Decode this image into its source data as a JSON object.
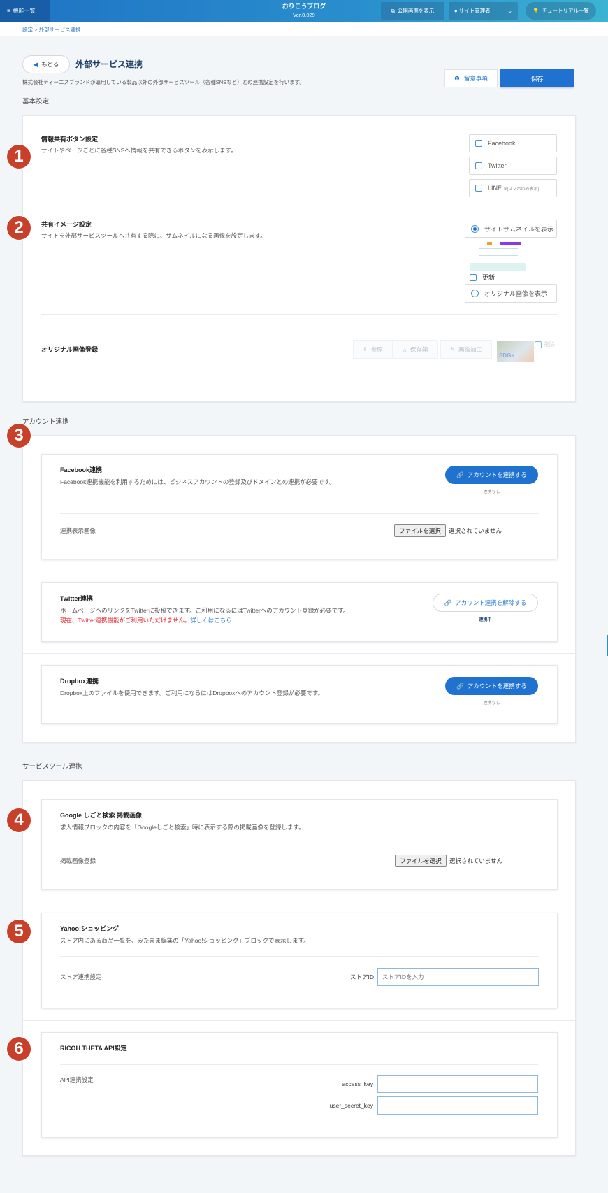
{
  "header": {
    "menu_label": "機能一覧",
    "app_title": "おりこうブログ",
    "version": "Ver.0.029",
    "view_public_label": "公開画面を表示",
    "site_admin_label": "サイト管理者",
    "tutorial_label": "チュートリアル一覧"
  },
  "breadcrumb": {
    "root": "設定",
    "separator": ">",
    "current": "外部サービス連携"
  },
  "page": {
    "back_label": "もどる",
    "title": "外部サービス連携",
    "description": "株式会社ディーエスブランドが運用している製品以外の外部サービスツール（各種SNSなど）との連携設定を行います。",
    "notes_label": "留意事項",
    "save_label": "保存"
  },
  "basic": {
    "heading": "基本設定",
    "share_buttons": {
      "badge": "1",
      "title": "情報共有ボタン設定",
      "description": "サイトやページごとに各種SNSへ情報を共有できるボタンを表示します。",
      "options": [
        {
          "label": "Facebook",
          "note": "",
          "checked": false
        },
        {
          "label": "Twitter",
          "note": "",
          "checked": false
        },
        {
          "label": "LINE",
          "note": "※(スマホのみ表示)",
          "checked": false
        }
      ]
    },
    "share_image": {
      "badge": "2",
      "title": "共有イメージ設定",
      "description": "サイトを外部サービスツールへ共有する際に、サムネイルになる画像を設定します。",
      "option_thumbnail": "サイトサムネイルを表示",
      "thumbnail_selected": true,
      "refresh_label": "更新",
      "option_original": "オリジナル画像を表示"
    },
    "original_image": {
      "label": "オリジナル画像登録",
      "browse_label": "参照",
      "storage_label": "保存箱",
      "edit_label": "画像加工",
      "thumb_text": "SDGs",
      "delete_label": "削除"
    }
  },
  "accounts": {
    "heading": "アカウント連携",
    "badge": "3",
    "facebook": {
      "title": "Facebook連携",
      "description": "Facebook連携機能を利用するためには、ビジネスアカウントの登録及びドメインとの連携が必要です。",
      "button": "アカウントを連携する",
      "status": "連携なし",
      "image_label": "連携表示画像",
      "file_button": "ファイルを選択",
      "file_status": "選択されていません"
    },
    "twitter": {
      "title": "Twitter連携",
      "description": "ホームページへのリンクをTwitterに投稿できます。ご利用になるにはTwitterへのアカウント登録が必要です。",
      "warning": "現在、Twitter連携機能がご利用いただけません。",
      "link": "詳しくはこちら",
      "button": "アカウント連携を解除する",
      "status": "連携中"
    },
    "dropbox": {
      "title": "Dropbox連携",
      "description": "Dropbox上のファイルを使用できます。ご利用になるにはDropboxへのアカウント登録が必要です。",
      "button": "アカウントを連携する",
      "status": "連携なし"
    }
  },
  "services": {
    "heading": "サービスツール連携",
    "google": {
      "badge": "4",
      "title": "Google しごと検索 掲載画像",
      "description": "求人情報ブロックの内容を「Googleしごと検索」時に表示する際の掲載画像を登録します。",
      "image_label": "掲載画像登録",
      "file_button": "ファイルを選択",
      "file_status": "選択されていません"
    },
    "yahoo": {
      "badge": "5",
      "title": "Yahoo!ショッピング",
      "description": "ストア内にある商品一覧を、みたまま編集の「Yahoo!ショッピング」ブロックで表示します。",
      "setting_label": "ストア連携設定",
      "store_id_label": "ストアID",
      "store_id_value": "",
      "store_id_placeholder": "ストアIDを入力"
    },
    "ricoh": {
      "badge": "6",
      "title": "RICOH THETA API設定",
      "setting_label": "API連携設定",
      "access_key_label": "access_key",
      "access_key_value": "",
      "secret_key_label": "user_secret_key",
      "secret_key_value": ""
    }
  },
  "colors": {
    "primary": "#1f72cf",
    "badge": "#c8402a",
    "warning": "#e8262b",
    "link": "#2a78cf"
  }
}
